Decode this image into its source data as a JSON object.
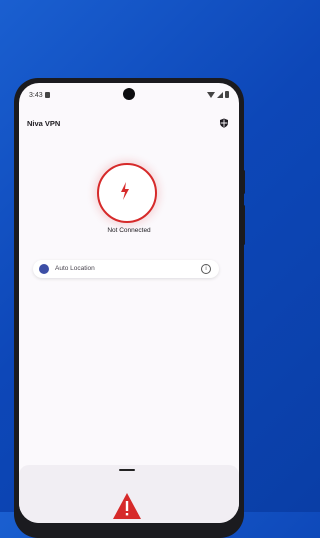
{
  "status_bar": {
    "time": "3:43"
  },
  "app": {
    "title": "Niva VPN"
  },
  "connection": {
    "status": "Not Connected"
  },
  "location": {
    "label": "Auto Location"
  },
  "icons": {
    "shield": "shield-icon",
    "bolt": "bolt-icon",
    "globe": "globe-icon",
    "info": "info-icon",
    "warning": "warning-icon"
  },
  "colors": {
    "accent": "#d62a2a",
    "background": "#0d47b8",
    "globe": "#3d4fa6"
  }
}
